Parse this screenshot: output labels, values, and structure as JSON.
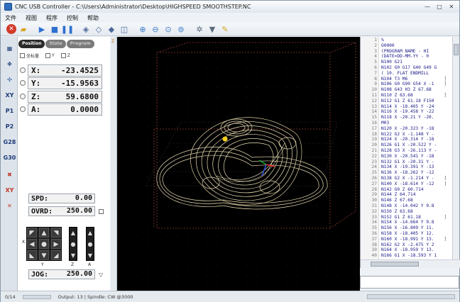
{
  "window": {
    "title": "CNC USB Controller - C:\\Users\\Administrator\\Desktop\\HIGHSPEED SMOOTHSTEP.NC",
    "minimize": "—",
    "maximize": "□",
    "close": "✕"
  },
  "menu": [
    "文件",
    "视图",
    "程序",
    "控制",
    "帮助"
  ],
  "toolbar_icons": [
    "stop-icon",
    "open-folder-icon",
    "play-icon",
    "stop-square-icon",
    "pause-icon",
    "view-cube-icon",
    "view-front-icon",
    "view-side-icon",
    "view-top-icon",
    "zoom-in-icon",
    "zoom-out-icon",
    "zoom-fit-icon",
    "zoom-window-icon",
    "settings-icon",
    "spindle-icon",
    "tool-icon"
  ],
  "tabs": [
    "Position",
    "State",
    "Program"
  ],
  "axis_checks": [
    "坐标量",
    "Y",
    "Z"
  ],
  "dro": [
    {
      "label": "X:",
      "value": "-23.4525"
    },
    {
      "label": "Y:",
      "value": "-15.9563"
    },
    {
      "label": "Z:",
      "value": "59.6800"
    },
    {
      "label": "A:",
      "value": "0.0000"
    }
  ],
  "side_icons": [
    "home-icon",
    "work-zero-icon",
    "xy-zero-icon",
    "p1-icon",
    "p2-icon",
    "g28-icon",
    "g30-icon",
    "probe-icon",
    "xy-clear-icon",
    "machine-icon"
  ],
  "side_labels": [
    "",
    "",
    "XY",
    "P1",
    "P2",
    "G28",
    "G30",
    "",
    "XY",
    ""
  ],
  "spd": {
    "label": "SPD:",
    "value": "0.00"
  },
  "ovrd": {
    "label": "OVRD:",
    "value": "250.00"
  },
  "jog": {
    "label": "JOG:",
    "value": "250.00"
  },
  "jog_axis_labels": [
    "Y",
    "Z",
    "A"
  ],
  "jog_x_label": "X",
  "ruler_mark": "Z",
  "code_lines": [
    {
      "n": "1",
      "t": "%"
    },
    {
      "n": "2",
      "t": "O0000"
    },
    {
      "n": "3",
      "t": "(PROGRAM NAME - HI"
    },
    {
      "n": "4",
      "t": "(DATE=DD-MM-YY - 0"
    },
    {
      "n": "5",
      "t": "N100 G21"
    },
    {
      "n": "6",
      "t": "N102 G0 G17 G40 G49 G"
    },
    {
      "n": "7",
      "t": "( 10. FLAT ENDMILL"
    },
    {
      "n": "8",
      "t": "N104 T3 M6"
    },
    {
      "n": "9",
      "t": "N106 G0 G90 G54 X -1"
    },
    {
      "n": "10",
      "t": "N108 G43 H3 Z 67.68"
    },
    {
      "n": "11",
      "t": "N110 Z 63.68"
    },
    {
      "n": "12",
      "t": "N112 G1 Z 61.18 F150"
    },
    {
      "n": "13",
      "t": "N114 X -18.405 Y -24"
    },
    {
      "n": "14",
      "t": "N116 X -19.458 Y -22"
    },
    {
      "n": "15",
      "t": "N118 X -20.21 Y -20."
    },
    {
      "n": "16",
      "t": "M03"
    },
    {
      "n": "17",
      "t": "N120 X -20.323 Y -18"
    },
    {
      "n": "18",
      "t": "N122 G2 X -1.148 Y -"
    },
    {
      "n": "19",
      "t": "N124 X -20.314 Y -18"
    },
    {
      "n": "20",
      "t": "N126 G1 X -20.522 Y -"
    },
    {
      "n": "21",
      "t": "N128 G3 X -26.113 Y -"
    },
    {
      "n": "22",
      "t": "N130 X -20.541 Y -18"
    },
    {
      "n": "23",
      "t": "N132 G1 X -20.31 Y -"
    },
    {
      "n": "24",
      "t": "N134 X -19.391 Y -13"
    },
    {
      "n": "25",
      "t": "N136 X -18.262 Y -12"
    },
    {
      "n": "26",
      "t": "N138 G2 X -1.214 Y -"
    },
    {
      "n": "27",
      "t": "N140 X -18.614 Y -12"
    },
    {
      "n": "28",
      "t": "N142 G0 Z 60.714"
    },
    {
      "n": "29",
      "t": "N144 Z 64.714"
    },
    {
      "n": "30",
      "t": "N146 Z 67.68"
    },
    {
      "n": "31",
      "t": "N148 X -14.042 Y 9.8"
    },
    {
      "n": "32",
      "t": "N150 Z 63.68"
    },
    {
      "n": "33",
      "t": "N152 G1 Z 61.18"
    },
    {
      "n": "34",
      "t": "N154 X -14.664 Y 9.8"
    },
    {
      "n": "35",
      "t": "N156 X -16.809 Y 11."
    },
    {
      "n": "36",
      "t": "N158 X -18.405 Y 12."
    },
    {
      "n": "37",
      "t": "N160 X -18.991 Y 13."
    },
    {
      "n": "38",
      "t": "N162 G2 X -2.475 Y 2"
    },
    {
      "n": "39",
      "t": "N164 X -18.959 Y 13."
    },
    {
      "n": "40",
      "t": "N166 G1 X -18.593 Y 1"
    }
  ],
  "code_marks": [
    {
      "row": 8,
      "t": "]"
    },
    {
      "row": 9,
      "t": "]"
    },
    {
      "row": 11,
      "t": "]"
    },
    {
      "row": 26,
      "t": "]"
    },
    {
      "row": 27,
      "t": "]"
    },
    {
      "row": 33,
      "t": "]"
    },
    {
      "row": 37,
      "t": "]"
    }
  ],
  "status": {
    "progress": "0/14",
    "progress_fraction": 0,
    "text": "Output: 13 | Spindle: CW @3000"
  }
}
